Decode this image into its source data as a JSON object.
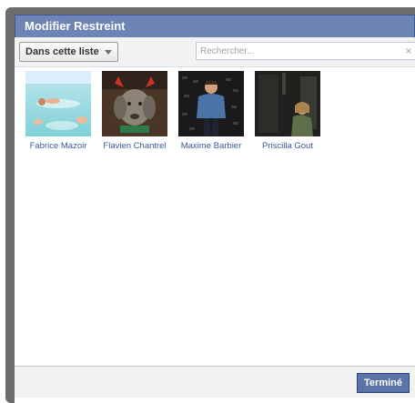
{
  "dialog": {
    "title": "Modifier Restreint"
  },
  "toolbar": {
    "filter_label": "Dans cette liste",
    "search_placeholder": "Rechercher...",
    "clear_symbol": "×"
  },
  "people": [
    {
      "name": "Fabrice Mazoir"
    },
    {
      "name": "Flavien Chantrel"
    },
    {
      "name": "Maxime Barbier"
    },
    {
      "name": "Priscilla Gout"
    }
  ],
  "footer": {
    "done_label": "Terminé"
  }
}
